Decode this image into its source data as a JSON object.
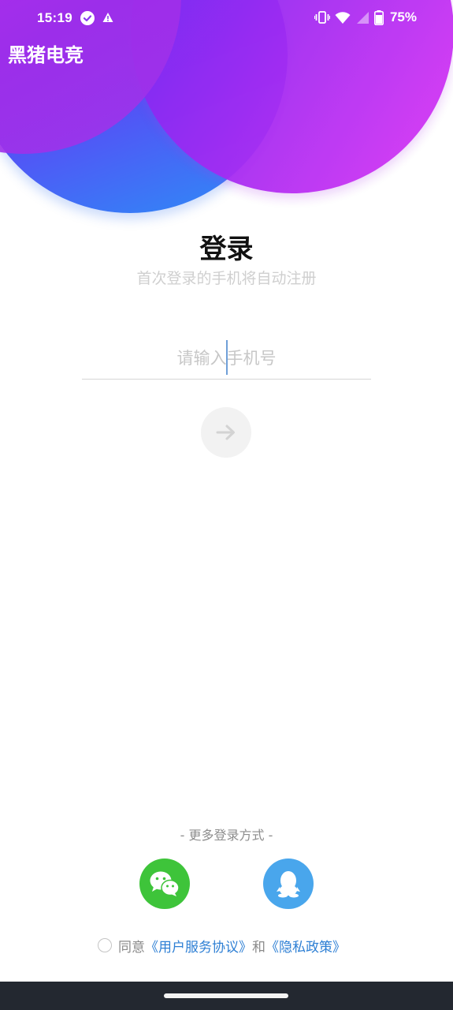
{
  "status_bar": {
    "time": "15:19",
    "battery": "75%",
    "icons": [
      "check-circle-icon",
      "warning-icon",
      "vibrate-icon",
      "wifi-icon",
      "signal-icon",
      "battery-icon"
    ]
  },
  "app": {
    "title": "黑猪电竞"
  },
  "login": {
    "title": "登录",
    "subtitle": "首次登录的手机将自动注册",
    "phone_placeholder": "请输入手机号",
    "phone_value": "",
    "submit_icon": "arrow-right-icon"
  },
  "more_login": {
    "label": "- 更多登录方式 -",
    "options": [
      {
        "name": "wechat",
        "icon": "wechat-icon",
        "color": "#3ec43a"
      },
      {
        "name": "qq",
        "icon": "qq-icon",
        "color": "#49a6ec"
      }
    ]
  },
  "agreement": {
    "prefix": "同意",
    "user_agreement": "《用户服务协议》",
    "conjunction": "和",
    "privacy_policy": "《隐私政策》",
    "checked": false
  },
  "colors": {
    "accent_purple": "#a32af2",
    "accent_blue": "#2c8ff7",
    "link": "#2d7fd4"
  }
}
